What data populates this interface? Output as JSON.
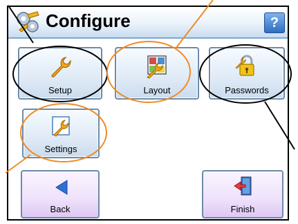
{
  "header": {
    "title": "Configure",
    "help_label": "?"
  },
  "tiles": [
    {
      "label": "Setup",
      "icon": "wrench-icon"
    },
    {
      "label": "Layout",
      "icon": "layout-grid-icon"
    },
    {
      "label": "Passwords",
      "icon": "padlock-icon"
    },
    {
      "label": "Settings",
      "icon": "wrench-settings-icon"
    }
  ],
  "nav": {
    "back_label": "Back",
    "finish_label": "Finish"
  },
  "colors": {
    "header_border": "#7fa6cf",
    "callout_black": "#000000",
    "callout_orange": "#f08a24",
    "back_arrow": "#2f6fd6"
  }
}
